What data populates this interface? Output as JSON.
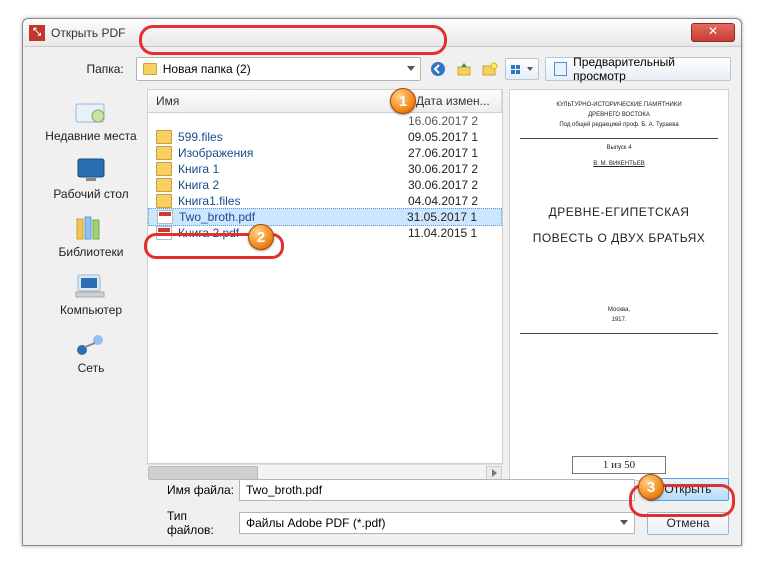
{
  "window_title": "Открыть PDF",
  "folder_label": "Папка:",
  "current_folder": "Новая папка (2)",
  "preview_button": "Предварительный просмотр",
  "columns": {
    "name": "Имя",
    "date": "Дата измен..."
  },
  "files": [
    {
      "name": "",
      "date": "16.06.2017 2",
      "type": "blank"
    },
    {
      "name": "599.files",
      "date": "09.05.2017 1",
      "type": "folder"
    },
    {
      "name": "Изображения",
      "date": "27.06.2017 1",
      "type": "folder"
    },
    {
      "name": "Книга 1",
      "date": "30.06.2017 2",
      "type": "folder"
    },
    {
      "name": "Книга 2",
      "date": "30.06.2017 2",
      "type": "folder"
    },
    {
      "name": "Книга1.files",
      "date": "04.04.2017 2",
      "type": "folder"
    },
    {
      "name": "Two_broth.pdf",
      "date": "31.05.2017 1",
      "type": "pdf",
      "selected": true
    },
    {
      "name": "Книга 2.pdf",
      "date": "11.04.2015 1",
      "type": "pdf"
    }
  ],
  "places": [
    {
      "id": "recent",
      "label": "Недавние места"
    },
    {
      "id": "desktop",
      "label": "Рабочий стол"
    },
    {
      "id": "libraries",
      "label": "Библиотеки"
    },
    {
      "id": "computer",
      "label": "Компьютер"
    },
    {
      "id": "network",
      "label": "Сеть"
    }
  ],
  "filename_label": "Имя файла:",
  "filename_value": "Two_broth.pdf",
  "filetype_label": "Тип файлов:",
  "filetype_value": "Файлы Adobe PDF (*.pdf)",
  "open_button": "Открыть",
  "cancel_button": "Отмена",
  "preview_doc": {
    "line1": "КУЛЬТУРНО-ИСТОРИЧЕСКИЕ ПАМЯТНИКИ",
    "line2": "ДРЕВНЕГО ВОСТОКА",
    "line3": "Под общей редакцией проф. Б. А. Тураева",
    "issue": "Выпуск 4",
    "author": "В. М. ВИКЕНТЬЕВ",
    "title1": "ДРЕВНЕ-ЕГИПЕТСКАЯ",
    "title2": "ПОВЕСТЬ О ДВУХ БРАТЬЯХ",
    "place": "Москва,",
    "year": "1917.",
    "page_counter": "1 из 50"
  },
  "callouts": {
    "c1": "1",
    "c2": "2",
    "c3": "3"
  }
}
